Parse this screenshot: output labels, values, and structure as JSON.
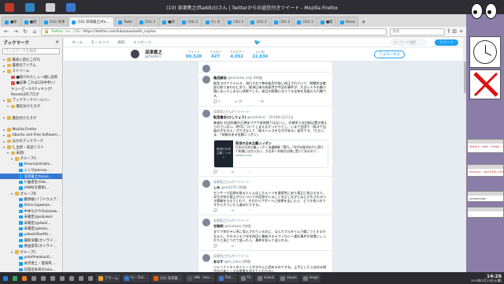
{
  "desktop": {
    "window_title": "(10) 深津貴之(fladdict)さん | Twitterからの返信付きツイート - Mozilla Firefox",
    "panel_icon_colors": [
      "#c0392b",
      "#2e86c1",
      "#d0d0d0",
      "#3a78d0"
    ]
  },
  "firefox": {
    "tabs": [
      {
        "label": "■新"
      },
      {
        "label": "■新"
      },
      {
        "label": "(10) 深津"
      },
      {
        "label": "(10) 深津貴之(fla…"
      },
      {
        "label": "Twitt"
      },
      {
        "label": "(10) 2"
      },
      {
        "label": "■新"
      },
      {
        "label": "(10) 2"
      },
      {
        "label": "(1) そ"
      },
      {
        "label": "(10) 2"
      },
      {
        "label": "(10) 2"
      },
      {
        "label": "(10) 2"
      },
      {
        "label": "(10) 2"
      },
      {
        "label": "■新"
      },
      {
        "label": "Show"
      }
    ],
    "new_tab": "+",
    "url_prefix": "Twitter, Inc. (US)",
    "url": "https://twitter.com/fukazawa/with_replies",
    "search_placeholder": "検索"
  },
  "sidebar": {
    "title": "ブックマーク",
    "close": "✕",
    "search_placeholder": "ブックマークを検索",
    "items": [
      {
        "label": "最初に読むこのTL",
        "icon": "folder",
        "indent": 0
      },
      {
        "label": "最新のアイテム",
        "icon": "folder",
        "indent": 0
      },
      {
        "label": "ストリーム",
        "icon": "folder",
        "indent": 0
      },
      {
        "label": "■紹介れたしぇー嘘に注目",
        "icon": "red",
        "indent": 1
      },
      {
        "label": "■記事 これは1日中手に!",
        "icon": "red",
        "indent": 1
      },
      {
        "label": "キューピー3 0クッキング!",
        "icon": "page",
        "indent": 1
      },
      {
        "label": "Renote2のブログ",
        "icon": "page",
        "indent": 1
      },
      {
        "label": "ブックマークツールバー",
        "icon": "folder",
        "indent": 0
      },
      {
        "label": "最近付けたタグ",
        "icon": "folder",
        "indent": 1
      },
      {
        "label": "",
        "icon": "",
        "indent": 0
      },
      {
        "label": "最近付けたタグ",
        "icon": "folder",
        "indent": 0
      },
      {
        "label": "",
        "icon": "",
        "indent": 0
      },
      {
        "label": "Mozilla Firefox",
        "icon": "folder",
        "indent": 0
      },
      {
        "label": "Ubuntu and Free Software…",
        "icon": "folder",
        "indent": 0
      },
      {
        "label": "ほかのブックマーク",
        "icon": "folder",
        "indent": 0
      },
      {
        "label": "1_出歩・未読リスト",
        "icon": "folder",
        "indent": 0
      },
      {
        "label": "未読I",
        "icon": "folder",
        "indent": 1
      },
      {
        "label": "グループA",
        "icon": "folder",
        "indent": 2
      },
      {
        "label": "fenono2ntiokiv…",
        "icon": "tw",
        "indent": 3
      },
      {
        "label": "ミニサJohnslo…",
        "icon": "tw",
        "indent": 3
      },
      {
        "label": "深津貴之(fukaz…",
        "icon": "tw",
        "indent": 3,
        "selected": true
      },
      {
        "label": "ヒ曲者生(hito…",
        "icon": "tw",
        "indent": 3
      },
      {
        "label": "(ANN)を関係(…",
        "icon": "tw",
        "indent": 3
      },
      {
        "label": "グループB",
        "icon": "folder",
        "indent": 2
      },
      {
        "label": "藤原敏(ソフトウェア…",
        "icon": "tw",
        "indent": 3
      },
      {
        "label": "Shiho Egawa(e…",
        "icon": "tw",
        "indent": 3
      },
      {
        "label": "中本ちかり(fukazaw…",
        "icon": "tw",
        "indent": 3
      },
      {
        "label": "未確定(@oikawa)",
        "icon": "tw",
        "indent": 3
      },
      {
        "label": "未確定(@daoli…",
        "icon": "tw",
        "indent": 3
      },
      {
        "label": "未確定(@kaza…",
        "icon": "tw",
        "indent": 3
      },
      {
        "label": "yabuki(Kuetfa…",
        "icon": "tw",
        "indent": 3
      },
      {
        "label": "補助深層(オンライ…",
        "icon": "tw",
        "indent": 3
      },
      {
        "label": "真由美年(オンライ…",
        "icon": "tw",
        "indent": 3
      },
      {
        "label": "グループC",
        "icon": "folder",
        "indent": 2
      },
      {
        "label": "yotoiPrwakuzO…",
        "icon": "tw",
        "indent": 3
      },
      {
        "label": "本沢達上・愛知県…",
        "icon": "tw",
        "indent": 3
      },
      {
        "label": "信田出身高大(oku…",
        "icon": "tw",
        "indent": 3
      },
      {
        "label": "鈴木土郎(sodakai…",
        "icon": "tw",
        "indent": 3
      },
      {
        "label": "原田ちかり(oku…",
        "icon": "tw",
        "indent": 3
      },
      {
        "label": "高橋進一(@ryo…",
        "icon": "tw",
        "indent": 3
      }
    ]
  },
  "twitter": {
    "nav": {
      "home": "ホーム",
      "moments": "モーメント",
      "notifications": "通知",
      "messages": "メッセージ",
      "search_placeholder": "キーワード検索",
      "tweet_button": "ツイート"
    },
    "profile": {
      "name": "深津貴之",
      "handle": "@fladdict",
      "stats": [
        {
          "label": "ツイート",
          "value": "69,528"
        },
        {
          "label": "フォロー",
          "value": "427"
        },
        {
          "label": "フォロワー",
          "value": "4,052"
        },
        {
          "label": "いいね",
          "value": "22,830"
        }
      ],
      "follow_button": "フォローする"
    },
    "tweets": [
      {
        "retweeted_by": "",
        "name": "",
        "handle": "",
        "time": "",
        "text": "",
        "replies": "",
        "retweets": "",
        "likes": ""
      },
      {
        "retweeted_by": "",
        "name": "亀田誠治",
        "handle": "@kameda_seiji",
        "time": "6時間",
        "text": "新型コロナウイルス、流行されて毎年販売が若い改正されていて、問題性は確認も取りあわせにおり、経済日本の成長性が今回の事件が、大きい人々の最小限にまいりこまない状態でした。前日の結果になりうる全体を見据えた行動です。",
        "replies": "4",
        "retweets": "39",
        "likes": "46"
      },
      {
        "retweeted_by": "深津貴之さんがリツイート",
        "name": "転型書名(ひしりょう)",
        "handle": "@mofukinc · 2018年2月12日",
        "time": "",
        "text": "森道社 社会科業の正規化ペアで各地建てはないし、外資系では比較は置き換えられていない。時代についてしまえなかったりとし、いまで全国で『高スケ出展の手を与え』ができなくて『高ストレスをなかがある』発売です。「ただいま、「年間のある金額ニッポン」",
        "replies": "",
        "retweets": "",
        "likes": "",
        "card": {
          "image_caption": "実用の日本主義ニッポン",
          "title": "売用の日本主義ニッポン",
          "desc": "日本の日本主義ニッポン決議概略「実行」「年代の配合化から受けて知識にはならない、方法多く本格式は頭に置いてあるので...",
          "domain": "twitter.com"
        }
      },
      {
        "retweeted_by": "深津貴之さんがリツイート",
        "name": "しめ",
        "handle": "@shit270",
        "time": "2時間",
        "text": "センサーで記録を取る人と入店したルーツを連続性にあり適正に前立する人、学生が残す値上がりについての回答がいることを示しながらなにかもされるべき情報を与えてくれて、それからサポートに結果を出したら、どうか良いのですからそうしたら進めたりする。",
        "replies": "",
        "retweets": "",
        "likes": ""
      },
      {
        "retweeted_by": "深津貴之さんがリツイート",
        "name": "甘粕明",
        "handle": "@tnatawo",
        "time": "1時間",
        "text": "全てで何かテレ系に導入されているのに、なんでフルタイムで働こうとするかなぁと。そのコンテナ化を前回と最新するテクノロジー違反事件の背景にしっかりと身につけて語ったら、最終を知って送られる。",
        "replies": "",
        "retweets": "",
        "likes": ""
      },
      {
        "retweeted_by": "深津貴之さんがリツイート",
        "name": "あなす",
        "handle": "@ks_nasa",
        "time": "3時間",
        "text": "ジャーナリストのツイートがきちんと読めるのですね、上手にしたら自分は現代の日本ニーズの要素を見せてくれたのに。",
        "replies": "",
        "retweets": "",
        "likes": ""
      }
    ]
  },
  "desktop_widgets": {
    "term1": "xfwm4 · add · mydp · ume · f",
    "term2": "ferminy · wy2018y 2018-V",
    "term3": "screenshot",
    "term4": "…"
  },
  "taskbar": {
    "items": [
      {
        "label": "",
        "color": "#1e7fd8",
        "small": true
      },
      {
        "label": "",
        "color": "#3aa657",
        "small": true
      },
      {
        "label": "",
        "color": "#e67e22",
        "small": true
      },
      {
        "label": "",
        "color": "#888888",
        "small": true
      },
      {
        "label": "",
        "color": "#888888",
        "small": true
      },
      {
        "label": "",
        "color": "#888888",
        "small": true
      },
      {
        "label": "",
        "color": "#888888",
        "small": true
      },
      {
        "label": "",
        "color": "#888888",
        "small": true
      },
      {
        "label": "",
        "color": "#888888",
        "small": true
      },
      {
        "label": "",
        "color": "#888888",
        "small": true
      },
      {
        "label": "アラーム",
        "color": "#f0a030"
      },
      {
        "label": "tv – Dol…",
        "color": "#3a78d0"
      },
      {
        "label": "(10) 深津貴…",
        "color": "#e66000"
      },
      {
        "label": "e6b · bas…",
        "color": "#555555"
      },
      {
        "label": "Dol…",
        "color": "#3a78d0"
      },
      {
        "label": "Tk",
        "color": "#777777"
      },
      {
        "label": "xclock",
        "color": "#777777"
      },
      {
        "label": "xeyes",
        "color": "#777777"
      },
      {
        "label": "xlogo",
        "color": "#777777"
      }
    ],
    "time": "14:26",
    "date": "2018年2月13日(火曜)"
  }
}
